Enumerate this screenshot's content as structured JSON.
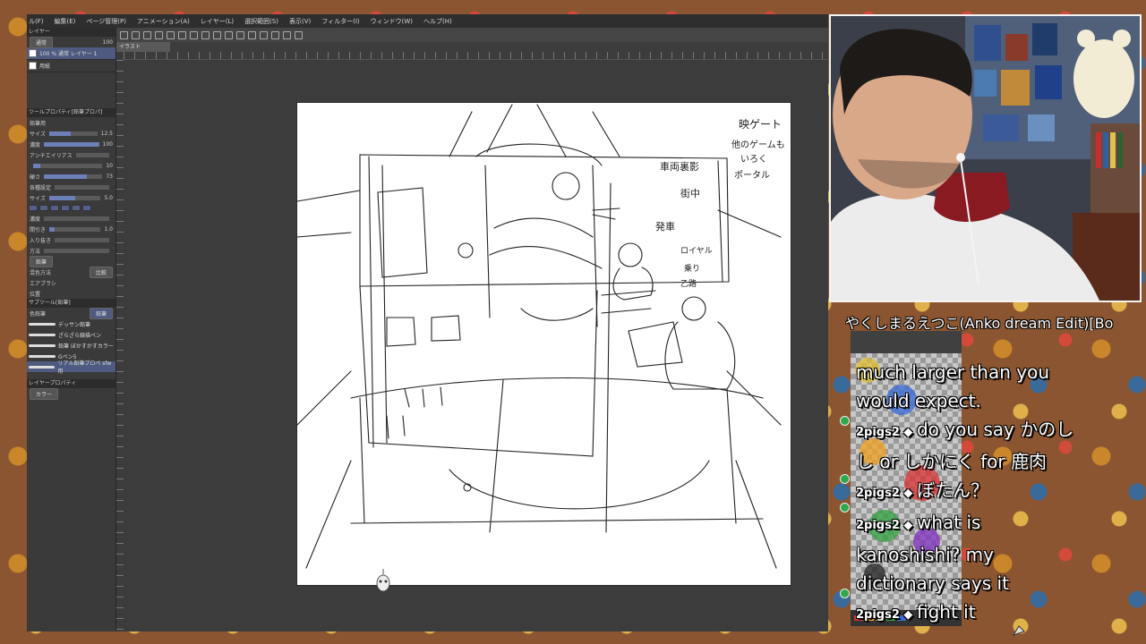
{
  "menubar": {
    "items": [
      "ル(F)",
      "編集(E)",
      "ページ管理(P)",
      "アニメーション(A)",
      "レイヤー(L)",
      "選択範囲(S)",
      "表示(V)",
      "フィルター(I)",
      "ウィンドウ(W)",
      "ヘルプ(H)"
    ]
  },
  "document": {
    "tab_label": "イラスト"
  },
  "layer_panel": {
    "title": "レイヤー",
    "blend_mode": "通常",
    "opacity": "100",
    "layers": [
      {
        "label": "100 % 通常 レイヤー 1",
        "selected": true
      },
      {
        "label": "用紙",
        "selected": false
      }
    ]
  },
  "tool_property": {
    "title": "ツールプロパティ[鉛筆プロパ]",
    "brush_name": "鉛筆用",
    "rows": [
      {
        "label": "サイズ",
        "value": "12.5",
        "level": 0.45
      },
      {
        "label": "濃度",
        "value": "100",
        "level": 1.0
      },
      {
        "label": "アンチエイリアス",
        "value": "",
        "level": 0
      },
      {
        "label": "",
        "value": "10",
        "level": 0.1
      },
      {
        "label": "硬さ",
        "value": "73",
        "level": 0.73
      },
      {
        "label": "各種設定",
        "value": "",
        "level": 0
      },
      {
        "label": "サイズ",
        "value": "5.0",
        "level": 0.5
      },
      {
        "label": "濃度",
        "value": "",
        "level": 0
      },
      {
        "label": "間引き",
        "value": "1.0",
        "level": 0.1
      },
      {
        "label": "入り抜き",
        "value": "",
        "level": 0
      },
      {
        "label": "方法",
        "value": "",
        "level": 0
      }
    ],
    "button_label": "鉛筆",
    "mix_label": "混色方法",
    "mix_value": "比較",
    "brush_section": "エアブラシ",
    "position_label": "位置"
  },
  "sub_tool": {
    "title": "サブツール[鉛筆]",
    "tabs": [
      "鉛筆",
      "色鉛筆"
    ],
    "items": [
      "デッサン鉛筆",
      "ざらざら線描ペン",
      "鉛筆 ぼかすかすカラー",
      "Gペン5",
      "リアル鉛筆ブロペ sfw用"
    ]
  },
  "layer_property": {
    "title": "レイヤープロパティ",
    "effect_label": "カラー"
  },
  "canvas": {
    "sketch_notes": [
      "映ゲート",
      "他のゲームも",
      "いろく",
      "ポータル",
      "車両裏影",
      "街中",
      "発車",
      "ロイヤル",
      "乗り",
      "乙路"
    ]
  },
  "chat": {
    "header": "やくしまるえつこ(Anko dream Edit)[Bo",
    "lines": [
      {
        "user": "",
        "text": "much larger than you",
        "badge": false
      },
      {
        "user": "",
        "text": "would expect.",
        "badge": false
      },
      {
        "user": "2pigs2",
        "text": "do you say かのし",
        "badge": true
      },
      {
        "user": "",
        "text": "し or しかにく for 鹿肉",
        "badge": false
      },
      {
        "user": "2pigs2",
        "text": "ぼたん？",
        "badge": true
      },
      {
        "user": "2pigs2",
        "text": "what is",
        "badge": true
      },
      {
        "user": "",
        "text": "kanoshishi? my",
        "badge": false
      },
      {
        "user": "",
        "text": "dictionary says it",
        "badge": false
      },
      {
        "user": "2pigs2",
        "text": "fight it",
        "badge": true
      }
    ]
  },
  "colors": {
    "app_bg": "#3c3c3c",
    "accent": "#4e5a80",
    "chat_badge": "#2fa84a"
  }
}
